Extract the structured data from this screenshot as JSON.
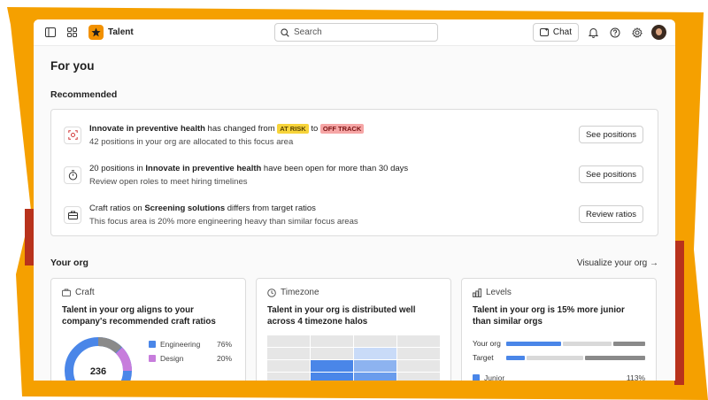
{
  "app": {
    "name": "Talent"
  },
  "search": {
    "placeholder": "Search"
  },
  "header": {
    "chat_label": "Chat"
  },
  "page": {
    "title": "For you"
  },
  "recommended": {
    "title": "Recommended",
    "items": [
      {
        "pre": "",
        "bold": "Innovate in preventive health",
        "mid": " has changed from ",
        "badge1": "AT RISK",
        "to": " to ",
        "badge2": "OFF TRACK",
        "sub": "42 positions in your org are allocated to this focus area",
        "button": "See positions",
        "icon": "focus-target-icon"
      },
      {
        "pre": "20 positions in ",
        "bold": "Innovate in preventive health",
        "post": " have been open for more than 30 days",
        "sub": "Review open roles to meet hiring timelines",
        "button": "See positions",
        "icon": "stopwatch-icon"
      },
      {
        "pre": "Craft ratios on ",
        "bold": "Screening solutions",
        "post": " differs from target ratios",
        "sub": "This focus area is 20% more engineering heavy than similar focus areas",
        "button": "Review ratios",
        "icon": "briefcase-icon"
      }
    ]
  },
  "org": {
    "title": "Your org",
    "visualize_link": "Visualize your org →",
    "craft": {
      "title": "Craft",
      "desc": "Talent in your org aligns to your company's recommended craft ratios",
      "total": "236",
      "legend": [
        {
          "label": "Engineering",
          "value": "76%",
          "color": "#4a86e8"
        },
        {
          "label": "Design",
          "value": "20%",
          "color": "#c77ddc"
        }
      ]
    },
    "timezone": {
      "title": "Timezone",
      "desc": "Talent in your org is distributed well across 4 timezone halos"
    },
    "levels": {
      "title": "Levels",
      "desc": "Talent in your org is 15% more junior than similar orgs",
      "rows": [
        {
          "label": "Your org"
        },
        {
          "label": "Target"
        }
      ],
      "legend": [
        {
          "label": "Junior",
          "value": "113%",
          "color": "#4a86e8"
        }
      ]
    }
  },
  "colors": {
    "accent": "#f29100",
    "background_orange": "#f5a000",
    "background_red": "#b8321c"
  }
}
